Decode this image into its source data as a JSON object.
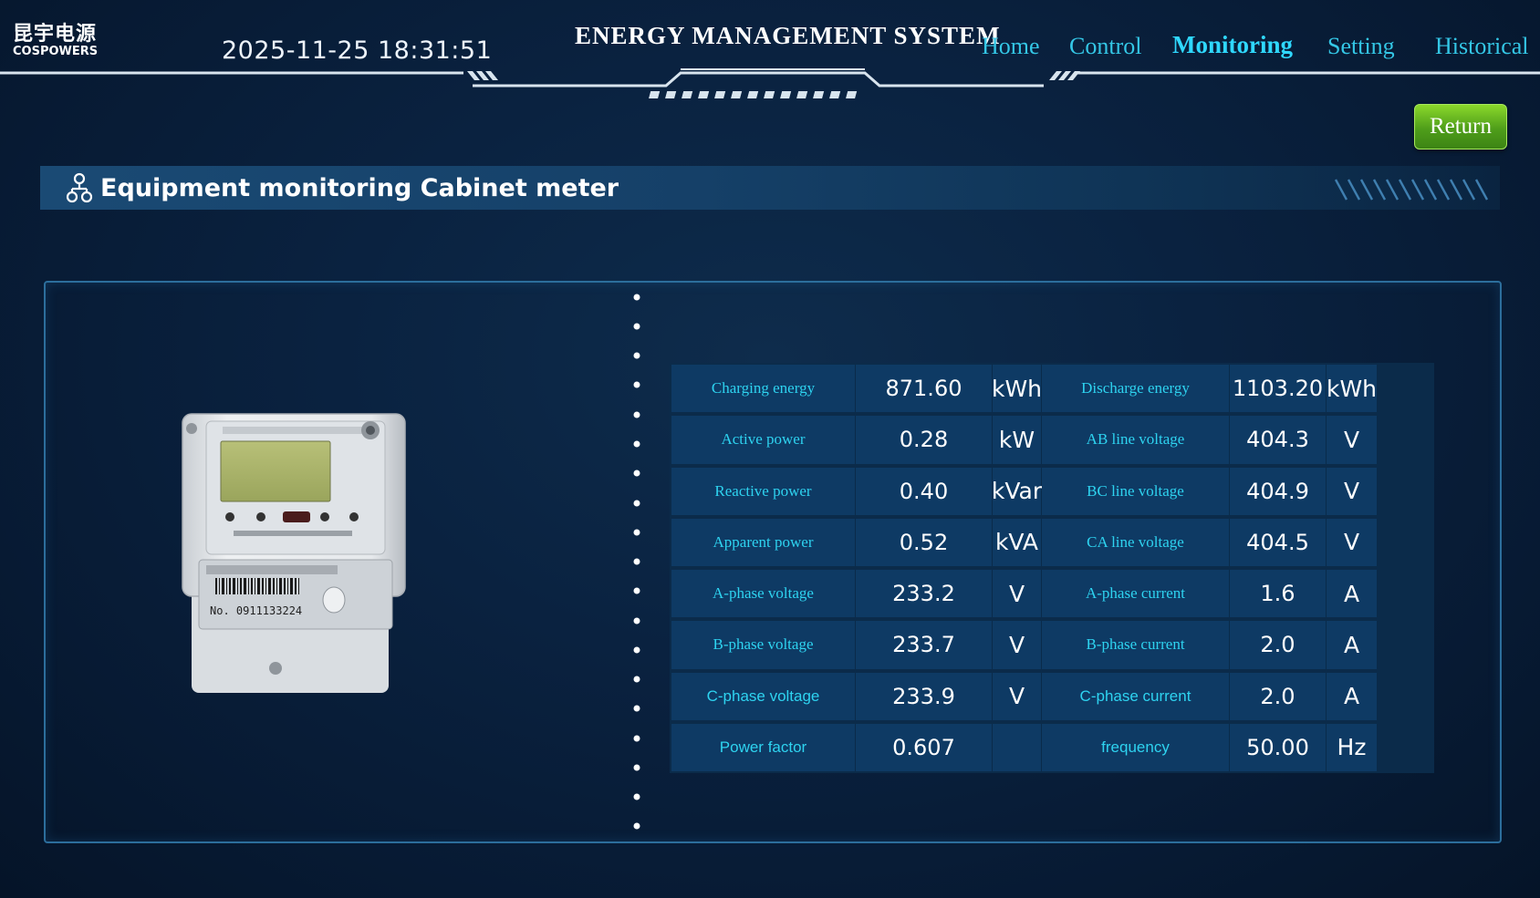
{
  "header": {
    "logo_cn": "昆宇电源",
    "logo_en": "COSPOWERS",
    "datetime": "2025-11-25 18:31:51",
    "system_title": "ENERGY MANAGEMENT SYSTEM",
    "nav": {
      "home": "Home",
      "control": "Control",
      "monitoring": "Monitoring",
      "setting": "Setting",
      "historical": "Historical"
    },
    "active_nav": "Monitoring"
  },
  "return_button": "Return",
  "section": {
    "title": "Equipment monitoring Cabinet meter",
    "icon": "equipment-network-icon"
  },
  "meter": {
    "serial_label": "No. 0911133224"
  },
  "readings": [
    {
      "left_label": "Charging energy",
      "left_value": "871.60",
      "left_unit": "kWh",
      "right_label": "Discharge energy",
      "right_value": "1103.20",
      "right_unit": "kWh"
    },
    {
      "left_label": "Active power",
      "left_value": "0.28",
      "left_unit": "kW",
      "right_label": "AB line voltage",
      "right_value": "404.3",
      "right_unit": "V"
    },
    {
      "left_label": "Reactive power",
      "left_value": "0.40",
      "left_unit": "kVar",
      "right_label": "BC line voltage",
      "right_value": "404.9",
      "right_unit": "V"
    },
    {
      "left_label": "Apparent power",
      "left_value": "0.52",
      "left_unit": "kVA",
      "right_label": "CA line voltage",
      "right_value": "404.5",
      "right_unit": "V"
    },
    {
      "left_label": "A-phase voltage",
      "left_value": "233.2",
      "left_unit": "V",
      "right_label": "A-phase current",
      "right_value": "1.6",
      "right_unit": "A"
    },
    {
      "left_label": "B-phase voltage",
      "left_value": "233.7",
      "left_unit": "V",
      "right_label": "B-phase current",
      "right_value": "2.0",
      "right_unit": "A"
    },
    {
      "left_label": "C-phase voltage",
      "left_value": "233.9",
      "left_unit": "V",
      "right_label": "C-phase current",
      "right_value": "2.0",
      "right_unit": "A"
    },
    {
      "left_label": "Power factor",
      "left_value": "0.607",
      "left_unit": "",
      "right_label": "frequency",
      "right_value": "50.00",
      "right_unit": "Hz"
    }
  ],
  "colors": {
    "background": "#0a2240",
    "accent_cyan": "#2ed3f0",
    "table_cell": "#0e3a64",
    "return_green": "#5fb420"
  }
}
